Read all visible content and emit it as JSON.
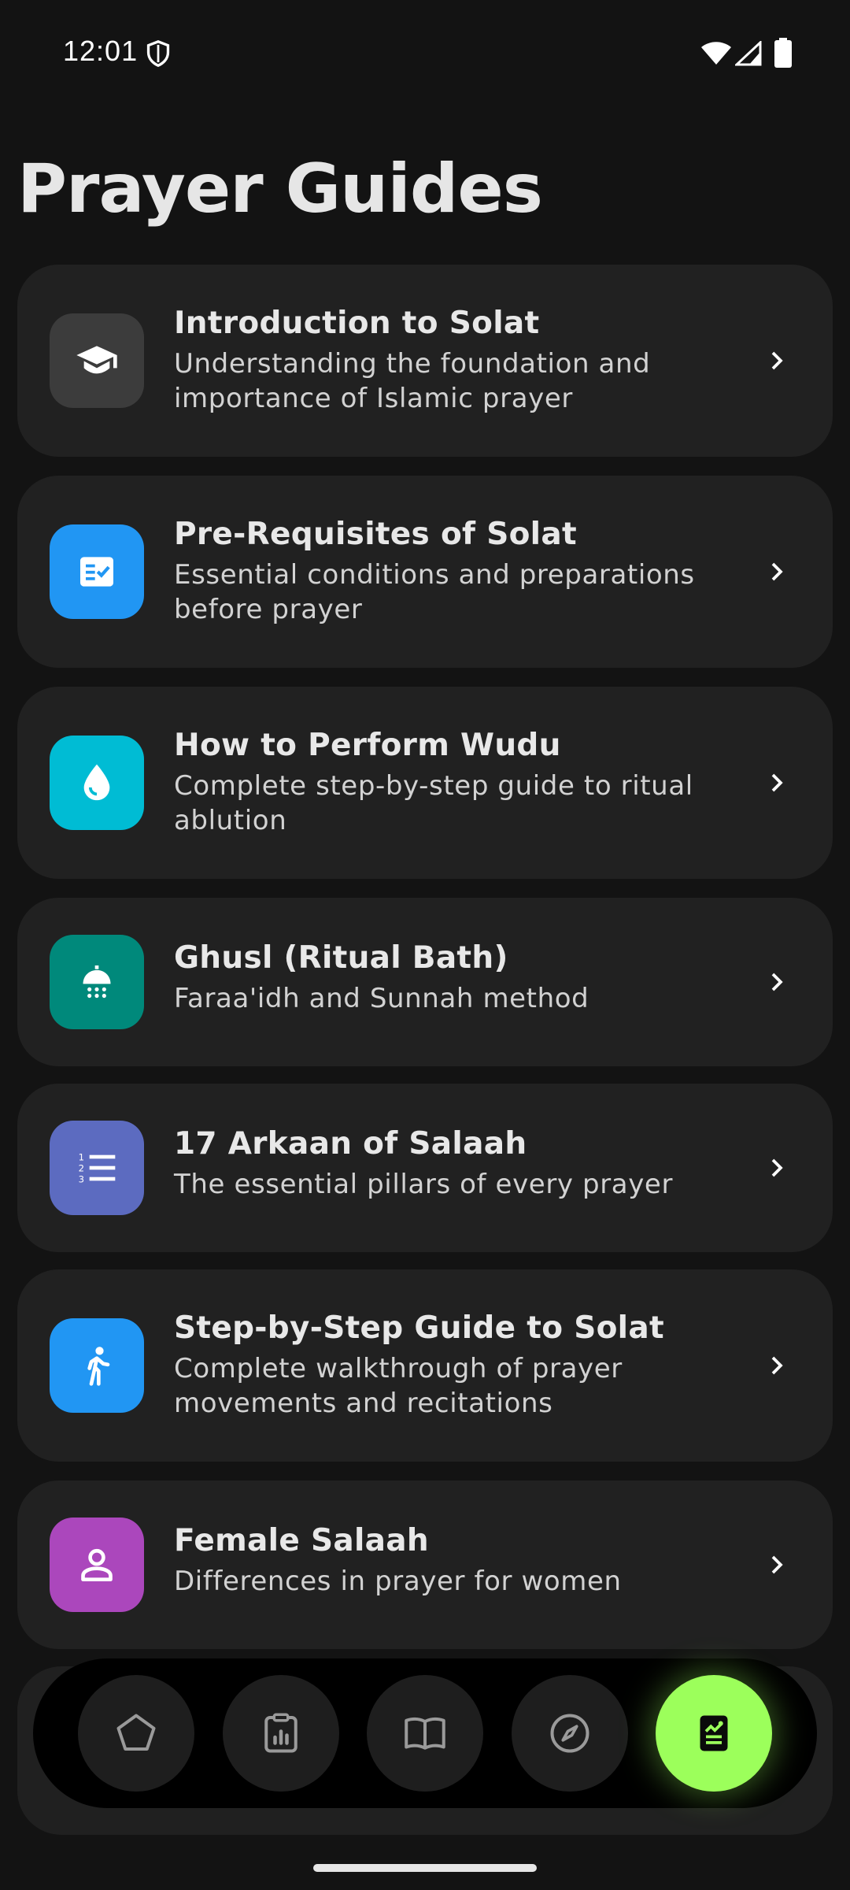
{
  "status_bar": {
    "time": "12:01"
  },
  "page": {
    "title": "Prayer Guides"
  },
  "guides": [
    {
      "title": "Introduction to Solat",
      "description": "Understanding the foundation and importance of Islamic prayer",
      "icon": "graduation-cap-icon",
      "color": "#3c3c3c"
    },
    {
      "title": "Pre-Requisites of Solat",
      "description": "Essential conditions and preparations before prayer",
      "icon": "checklist-icon",
      "color": "#2196f3"
    },
    {
      "title": "How to Perform Wudu",
      "description": "Complete step-by-step guide to ritual ablution",
      "icon": "water-drop-icon",
      "color": "#00bcd4"
    },
    {
      "title": "Ghusl (Ritual Bath)",
      "description": "Faraa'idh and Sunnah method",
      "icon": "shower-icon",
      "color": "#00897b"
    },
    {
      "title": "17 Arkaan of Salaah",
      "description": "The essential pillars of every prayer",
      "icon": "numbered-list-icon",
      "color": "#5c6bc0"
    },
    {
      "title": "Step-by-Step Guide to Solat",
      "description": "Complete walkthrough of prayer movements and recitations",
      "icon": "walking-person-icon",
      "color": "#2196f3"
    },
    {
      "title": "Female Salaah",
      "description": "Differences in prayer for women",
      "icon": "person-icon",
      "color": "#ab47bc"
    }
  ],
  "bottom_nav": {
    "items": [
      {
        "icon": "pentagon-icon",
        "active": false
      },
      {
        "icon": "clipboard-chart-icon",
        "active": false
      },
      {
        "icon": "open-book-icon",
        "active": false
      },
      {
        "icon": "compass-icon",
        "active": false
      },
      {
        "icon": "guide-document-icon",
        "active": true
      }
    ],
    "active_color": "#9cff5b"
  }
}
